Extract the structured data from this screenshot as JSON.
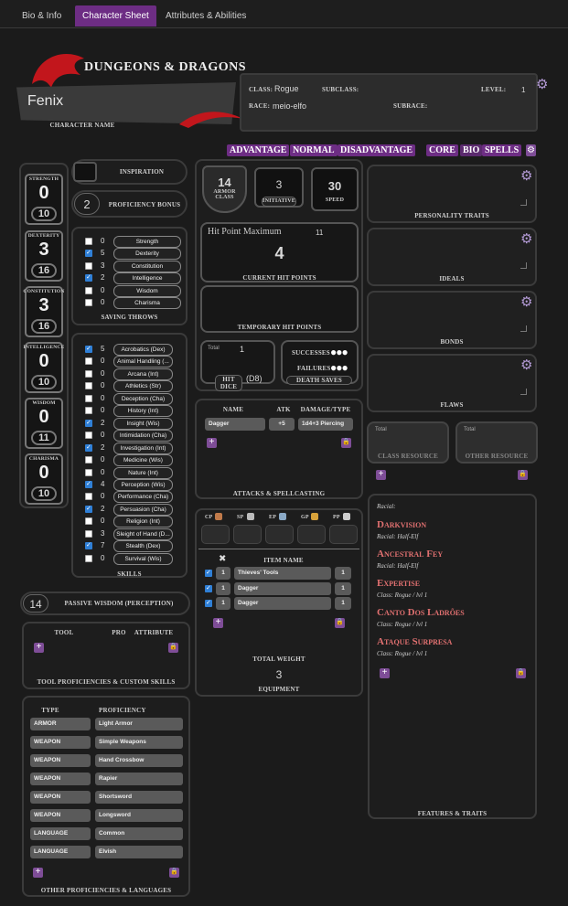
{
  "tabs": [
    "Bio & Info",
    "Character Sheet",
    "Attributes & Abilities"
  ],
  "header": {
    "logo": "DUNGEONS & DRAGONS",
    "character_name": "Fenix",
    "character_name_label": "CHARACTER NAME",
    "class_label": "CLASS:",
    "class": "Rogue",
    "subclass_label": "SUBCLASS:",
    "level_label": "LEVEL:",
    "level": "1",
    "race_label": "RACE:",
    "race": "meio-elfo",
    "subrace_label": "SUBRACE:"
  },
  "roll_modes": [
    "ADVANTAGE",
    "NORMAL",
    "DISADVANTAGE"
  ],
  "sheet_modes": [
    "CORE",
    "BIO",
    "SPELLS"
  ],
  "abilities": [
    {
      "name": "STRENGTH",
      "mod": "0",
      "score": "10"
    },
    {
      "name": "DEXTERITY",
      "mod": "3",
      "score": "16"
    },
    {
      "name": "CONSTITUTION",
      "mod": "3",
      "score": "16"
    },
    {
      "name": "INTELLIGENCE",
      "mod": "0",
      "score": "10"
    },
    {
      "name": "WISDOM",
      "mod": "0",
      "score": "11"
    },
    {
      "name": "CHARISMA",
      "mod": "0",
      "score": "10"
    }
  ],
  "inspiration_label": "INSPIRATION",
  "proficiency": {
    "value": "2",
    "label": "PROFICIENCY BONUS"
  },
  "saves": {
    "label": "SAVING THROWS",
    "items": [
      {
        "checked": false,
        "val": "0",
        "name": "Strength"
      },
      {
        "checked": true,
        "val": "5",
        "name": "Dexterity"
      },
      {
        "checked": false,
        "val": "3",
        "name": "Constitution"
      },
      {
        "checked": true,
        "val": "2",
        "name": "Intelligence"
      },
      {
        "checked": false,
        "val": "0",
        "name": "Wisdom"
      },
      {
        "checked": false,
        "val": "0",
        "name": "Charisma"
      }
    ]
  },
  "skills": {
    "label": "SKILLS",
    "items": [
      {
        "checked": true,
        "val": "5",
        "name": "Acrobatics (Dex)"
      },
      {
        "checked": false,
        "val": "0",
        "name": "Animal Handling (..."
      },
      {
        "checked": false,
        "val": "0",
        "name": "Arcana (Int)"
      },
      {
        "checked": false,
        "val": "0",
        "name": "Athletics (Str)"
      },
      {
        "checked": false,
        "val": "0",
        "name": "Deception (Cha)"
      },
      {
        "checked": false,
        "val": "0",
        "name": "History (Int)"
      },
      {
        "checked": true,
        "val": "2",
        "name": "Insight (Wis)"
      },
      {
        "checked": false,
        "val": "0",
        "name": "Intimidation (Cha)"
      },
      {
        "checked": true,
        "val": "2",
        "name": "Investigation (Int)"
      },
      {
        "checked": false,
        "val": "0",
        "name": "Medicine (Wis)"
      },
      {
        "checked": false,
        "val": "0",
        "name": "Nature (Int)"
      },
      {
        "checked": true,
        "val": "4",
        "name": "Perception (Wis)"
      },
      {
        "checked": false,
        "val": "0",
        "name": "Performance (Cha)"
      },
      {
        "checked": true,
        "val": "2",
        "name": "Persuasion (Cha)"
      },
      {
        "checked": false,
        "val": "0",
        "name": "Religion (Int)"
      },
      {
        "checked": false,
        "val": "3",
        "name": "Sleight of Hand (D..."
      },
      {
        "checked": true,
        "val": "7",
        "name": "Stealth (Dex)"
      },
      {
        "checked": false,
        "val": "0",
        "name": "Survival (Wis)"
      }
    ]
  },
  "passive": {
    "value": "14",
    "label": "PASSIVE WISDOM (PERCEPTION)"
  },
  "tool_prof": {
    "label": "TOOL PROFICIENCIES & CUSTOM SKILLS",
    "headers": [
      "TOOL",
      "PRO",
      "ATTRIBUTE"
    ]
  },
  "other_prof": {
    "label": "OTHER PROFICIENCIES & LANGUAGES",
    "headers": [
      "TYPE",
      "PROFICIENCY"
    ],
    "rows": [
      [
        "ARMOR",
        "Light Armor"
      ],
      [
        "WEAPON",
        "Simple Weapons"
      ],
      [
        "WEAPON",
        "Hand Crossbow"
      ],
      [
        "WEAPON",
        "Rapier"
      ],
      [
        "WEAPON",
        "Shortsword"
      ],
      [
        "WEAPON",
        "Longsword"
      ],
      [
        "LANGUAGE",
        "Common"
      ],
      [
        "LANGUAGE",
        "Elvish"
      ]
    ]
  },
  "combat": {
    "ac": "14",
    "ac_label": "ARMOR CLASS",
    "initiative": "3",
    "initiative_label": "INITIATIVE",
    "speed": "30",
    "speed_label": "SPEED"
  },
  "hp": {
    "max_label": "Hit Point Maximum",
    "max": "11",
    "current": "4",
    "current_label": "CURRENT HIT POINTS",
    "temp_label": "TEMPORARY HIT POINTS"
  },
  "hit_dice": {
    "total_label": "Total",
    "total": "1",
    "label": "HIT DICE",
    "die": "(D8)"
  },
  "death_saves": {
    "successes": "SUCCESSES",
    "failures": "FAILURES",
    "label": "DEATH SAVES"
  },
  "attacks": {
    "label": "ATTACKS & SPELLCASTING",
    "headers": [
      "NAME",
      "ATK",
      "DAMAGE/TYPE"
    ],
    "rows": [
      [
        "Dagger",
        "+5",
        "1d4+3 Piercing"
      ]
    ]
  },
  "coins": [
    "CP",
    "SP",
    "EP",
    "GP",
    "PP"
  ],
  "equipment": {
    "label": "EQUIPMENT",
    "item_header": "ITEM NAME",
    "items": [
      [
        "1",
        "Thieves' Tools",
        "1"
      ],
      [
        "1",
        "Dagger",
        "1"
      ],
      [
        "1",
        "Dagger",
        "1"
      ]
    ],
    "weight_label": "TOTAL WEIGHT",
    "weight": "3"
  },
  "traits": [
    "PERSONALITY TRAITS",
    "IDEALS",
    "BONDS",
    "FLAWS"
  ],
  "resources": {
    "total_label": "Total",
    "class": "CLASS RESOURCE",
    "other": "OTHER RESOURCE"
  },
  "features": {
    "label": "FEATURES & TRAITS",
    "racial": "Racial:",
    "items": [
      {
        "title": "Darkvision",
        "source": "Racial: Half-Elf"
      },
      {
        "title": "Ancestral Fey",
        "source": "Racial: Half-Elf"
      },
      {
        "title": "Expertise",
        "source": "Class: Rogue / lvl 1"
      },
      {
        "title": "Canto Dos Ladrões",
        "source": "Class: Rogue / lvl 1"
      },
      {
        "title": "Ataque Surpresa",
        "source": "Class: Rogue / lvl 1"
      }
    ]
  }
}
